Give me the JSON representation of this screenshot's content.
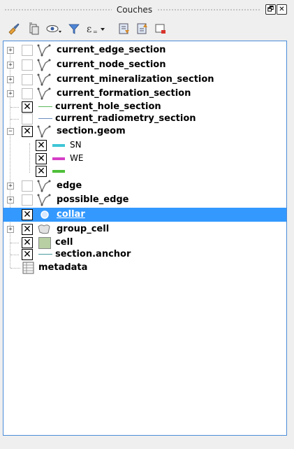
{
  "panel": {
    "title": "Couches"
  },
  "title_buttons": [
    {
      "name": "float-button",
      "glyph": "🗗"
    },
    {
      "name": "close-button",
      "glyph": "✕"
    }
  ],
  "toolbar": [
    "style-manager-icon",
    "add-group-icon",
    "visibility-eye-icon",
    "filter-icon",
    "filter-expression-icon",
    "expand-all-icon",
    "collapse-all-icon",
    "remove-layer-icon"
  ],
  "layers": [
    {
      "label": "current_edge_section",
      "checked": false,
      "expandable": true,
      "icon": "line-geometry-icon"
    },
    {
      "label": "current_node_section",
      "checked": false,
      "expandable": true,
      "icon": "line-geometry-icon"
    },
    {
      "label": "current_mineralization_section",
      "checked": false,
      "expandable": true,
      "icon": "line-geometry-icon"
    },
    {
      "label": "current_formation_section",
      "checked": false,
      "expandable": true,
      "icon": "line-geometry-icon"
    },
    {
      "label": "current_hole_section",
      "checked": true,
      "expandable": false,
      "icon": "line-symbol-icon",
      "color": "#5cb85c"
    },
    {
      "label": "current_radiometry_section",
      "checked": false,
      "expandable": false,
      "icon": "line-symbol-icon",
      "color": "#6b8fbf"
    },
    {
      "label": "section.geom",
      "checked": true,
      "expandable": true,
      "expanded": true,
      "icon": "line-geometry-icon"
    },
    {
      "label": "SN",
      "checked": true,
      "child": true,
      "color": "#3fc6d6"
    },
    {
      "label": "WE",
      "checked": true,
      "child": true,
      "color": "#d63fc6"
    },
    {
      "label": "",
      "checked": true,
      "child": true,
      "color": "#4fbf3a"
    },
    {
      "label": "edge",
      "checked": false,
      "expandable": true,
      "icon": "line-geometry-icon"
    },
    {
      "label": "possible_edge",
      "checked": false,
      "expandable": true,
      "icon": "line-geometry-icon"
    },
    {
      "label": "collar",
      "checked": true,
      "expandable": false,
      "icon": "point-symbol-icon",
      "selected": true
    },
    {
      "label": "group_cell",
      "checked": true,
      "expandable": true,
      "icon": "polygon-geometry-icon"
    },
    {
      "label": "cell",
      "checked": true,
      "expandable": false,
      "icon": "fill-symbol-icon",
      "color": "#b7cfa3"
    },
    {
      "label": "section.anchor",
      "checked": true,
      "expandable": false,
      "icon": "line-symbol-icon",
      "color": "#4a9aa0"
    },
    {
      "label": "metadata",
      "checked": null,
      "expandable": false,
      "icon": "table-icon"
    }
  ]
}
